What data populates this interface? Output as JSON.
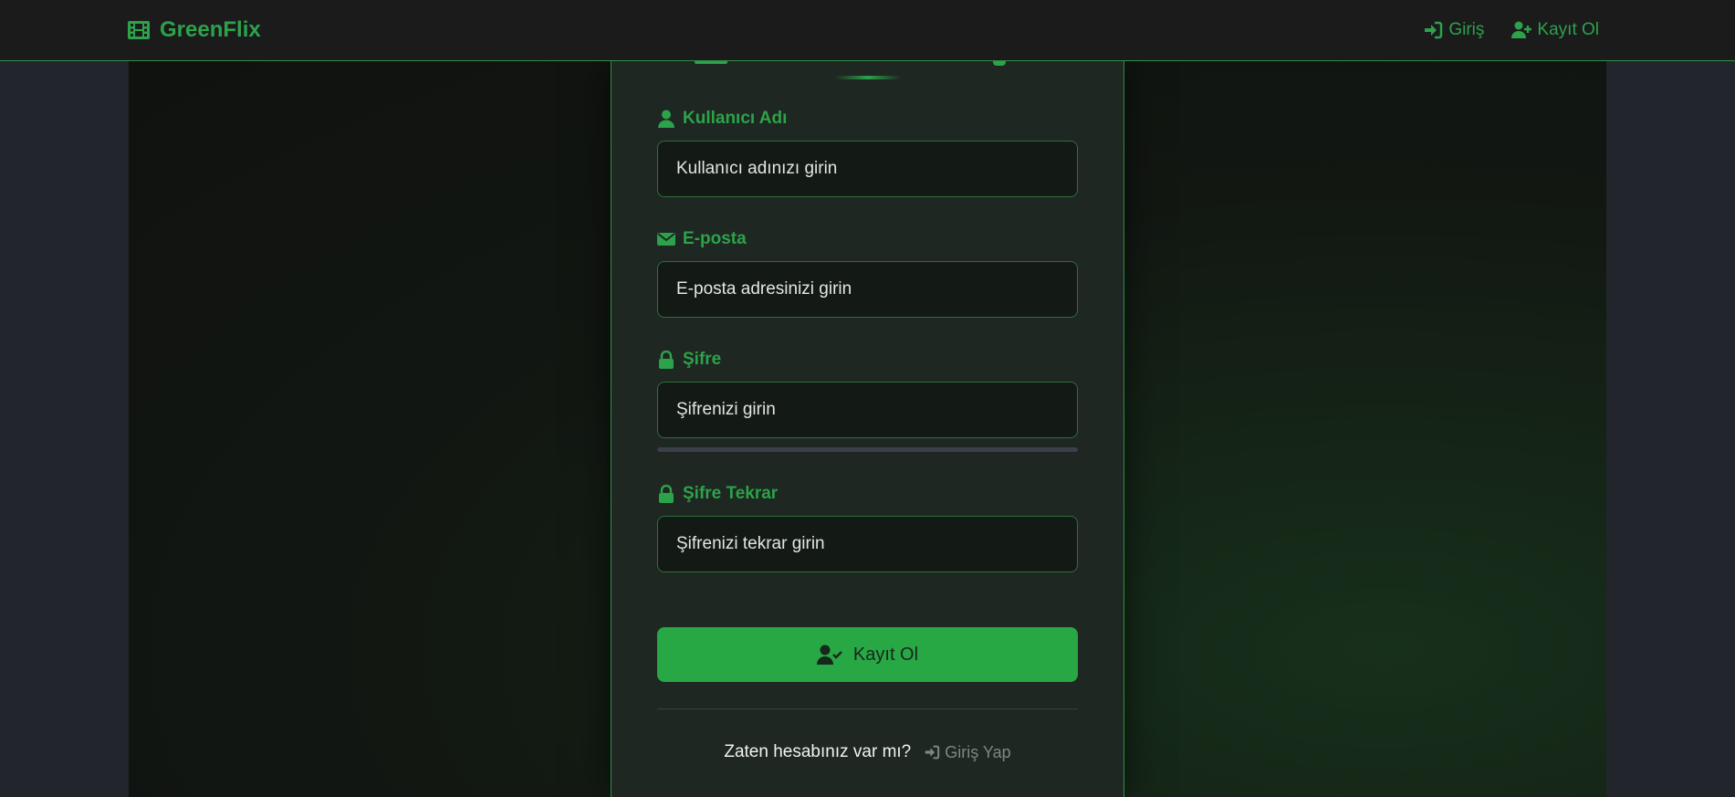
{
  "nav": {
    "brand": "GreenFlix",
    "brand_icon": "film-icon",
    "links": [
      {
        "label": "Giriş",
        "icon": "sign-in-icon"
      },
      {
        "label": "Kayıt Ol",
        "icon": "user-plus-icon"
      }
    ]
  },
  "form": {
    "fields": [
      {
        "label": "Kullanıcı Adı",
        "icon": "user-icon",
        "placeholder": "Kullanıcı adınızı girin",
        "value": ""
      },
      {
        "label": "E-posta",
        "icon": "envelope-icon",
        "placeholder": "E-posta adresinizi girin",
        "value": ""
      },
      {
        "label": "Şifre",
        "icon": "lock-icon",
        "placeholder": "Şifrenizi girin",
        "value": ""
      },
      {
        "label": "Şifre Tekrar",
        "icon": "lock-icon",
        "placeholder": "Şifrenizi tekrar girin",
        "value": ""
      }
    ],
    "submit_label": "Kayıt Ol",
    "submit_icon": "user-check-icon",
    "footer_text": "Zaten hesabınız var mı?",
    "footer_link": "Giriş Yap",
    "footer_link_icon": "sign-in-icon"
  },
  "colors": {
    "accent": "#28a745",
    "navbar_bg": "#1b1b1c",
    "card_bg": "#1e2721",
    "page_bg": "#22252b"
  }
}
